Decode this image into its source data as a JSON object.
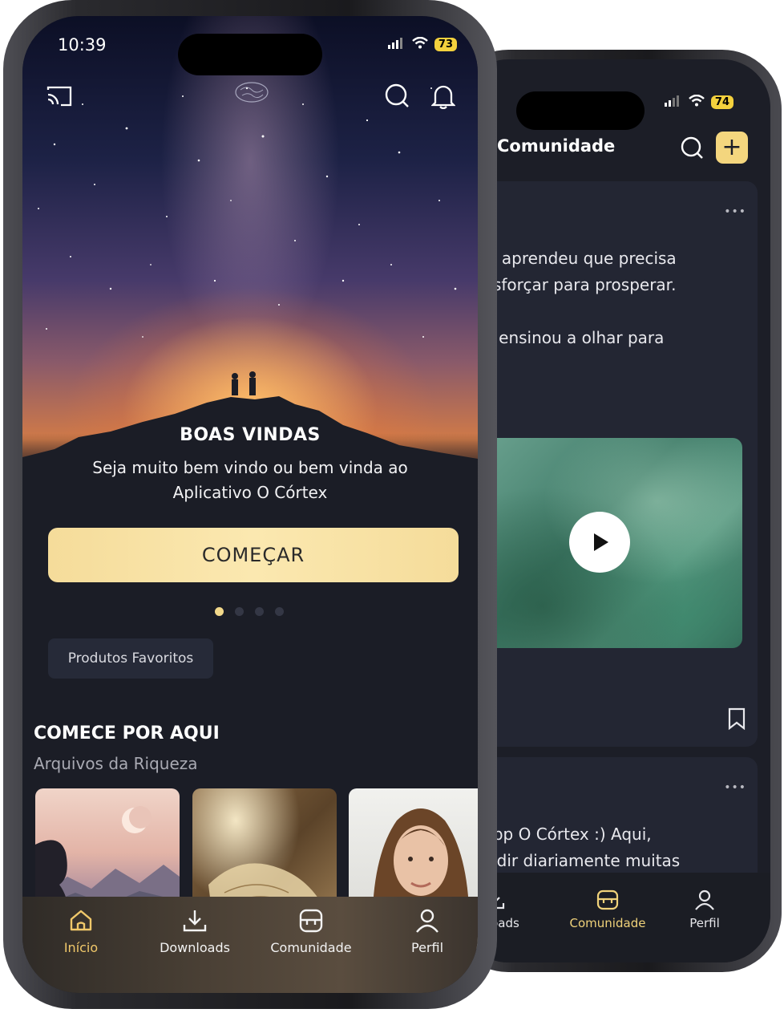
{
  "front": {
    "status": {
      "time": "10:39",
      "battery": "73"
    },
    "welcome": {
      "title": "BOAS VINDAS",
      "subtitle": "Seja muito bem vindo ou bem vinda ao Aplicativo O Córtex"
    },
    "start_button": "COMEÇAR",
    "pager": {
      "count": 4,
      "active": 0
    },
    "chip_label": "Produtos Favoritos",
    "section": {
      "title": "COMECE POR AQUI",
      "subtitle": "Arquivos da Riqueza"
    },
    "nav": [
      {
        "label": "Início",
        "icon": "home-icon",
        "active": true
      },
      {
        "label": "Downloads",
        "icon": "download-icon",
        "active": false
      },
      {
        "label": "Comunidade",
        "icon": "community-icon",
        "active": false
      },
      {
        "label": "Perfil",
        "icon": "profile-icon",
        "active": false
      }
    ]
  },
  "back": {
    "status": {
      "battery": "74"
    },
    "title": "Comunidade",
    "post1_text": "ocê aprendeu que precisa\ne esforçar para prosperar.\n\nme ensinou a olhar para",
    "post2_text": "o app O Córtex :) Aqui,\ndividir diariamente muitas",
    "nav": [
      {
        "label": "wnloads",
        "icon": "download-icon",
        "active": false
      },
      {
        "label": "Comunidade",
        "icon": "community-icon",
        "active": true
      },
      {
        "label": "Perfil",
        "icon": "profile-icon",
        "active": false
      }
    ]
  },
  "colors": {
    "accent": "#f4d67e",
    "background": "#1b1d26",
    "card": "#232633"
  }
}
